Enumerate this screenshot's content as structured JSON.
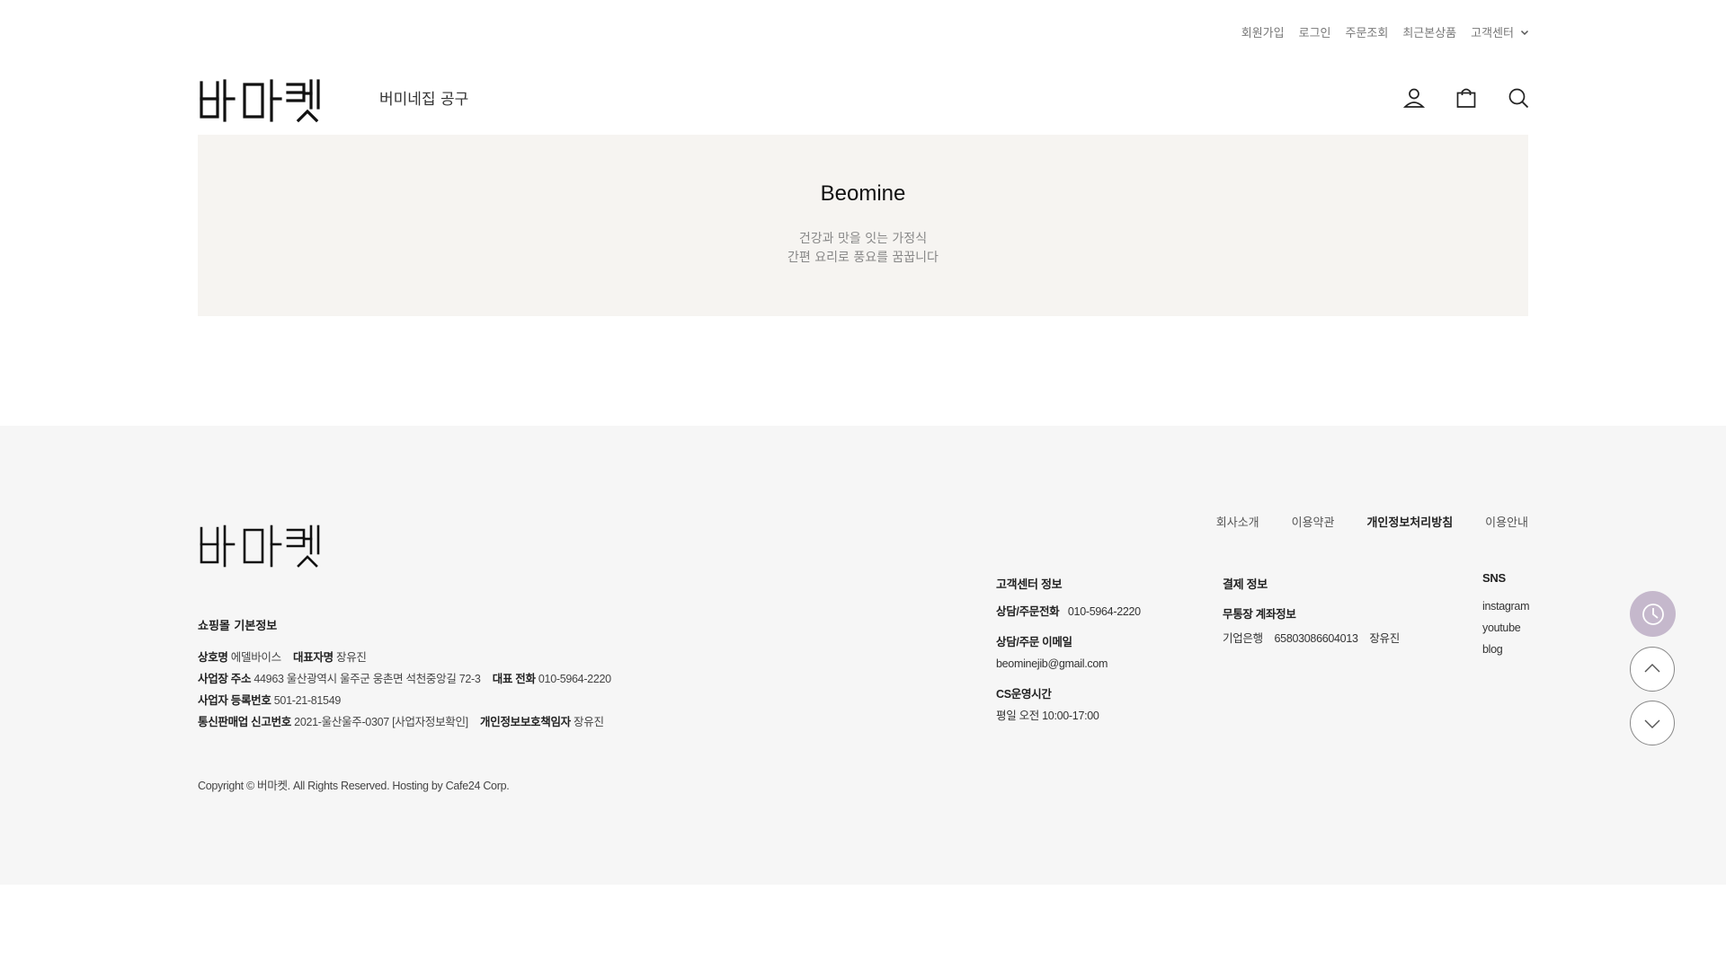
{
  "topbar": {
    "items": [
      "회원가입",
      "로그인",
      "주문조회",
      "최근본상품"
    ],
    "customer_center": "고객센터"
  },
  "header": {
    "nav_link": "버미네집 공구",
    "icons": [
      "user-icon",
      "shopping-bag-icon",
      "search-icon"
    ]
  },
  "hero": {
    "title": "Beomine",
    "sub_line1": "건강과 맛을 잇는 가정식",
    "sub_line2": "간편 요리로 풍요를 꿈꿉니다"
  },
  "footer": {
    "links": [
      "회사소개",
      "이용약관",
      "개인정보처리방침",
      "이용안내"
    ],
    "info_title": "쇼핑몰 기본정보",
    "company_label": "상호명",
    "company_value": "에델바이스",
    "ceo_label": "대표자명",
    "ceo_value": "장유진",
    "address_label": "사업장 주소",
    "address_value": "44963 울산광역시 울주군 웅촌면 석천중앙길 72-3",
    "phone_label": "대표 전화",
    "phone_value": "010-5964-2220",
    "bizno_label": "사업자 등록번호",
    "bizno_value": "501-21-81549",
    "mailorder_label": "통신판매업 신고번호",
    "mailorder_value": "2021-울산울주-0307",
    "bizinfo_link": "[사업자정보확인]",
    "privacy_label": "개인정보보호책임자",
    "privacy_value": "장유진",
    "copyright": "Copyright © 버마켓. All Rights Reserved. Hosting by Cafe24 Corp.",
    "cs": {
      "title": "고객센터 정보",
      "phone_label": "상담/주문전화",
      "phone_value": "010-5964-2220",
      "email_label": "상담/주문 이메일",
      "email_value": "beominejib@gmail.com",
      "hours_label": "CS운영시간",
      "hours_value": "평일 오전 10:00-17:00"
    },
    "pay": {
      "title": "결제 정보",
      "account_label": "무통장 계좌정보",
      "bank": "기업은행",
      "account_no": "65803086604013",
      "holder": "장유진"
    },
    "sns": {
      "title": "SNS",
      "links": [
        "instagram",
        "youtube",
        "blog"
      ]
    }
  },
  "colors": {
    "hero_bg": "#f6f4f1",
    "footer_bg": "#f6f6f6",
    "recent_button": "#c5b8cc"
  }
}
